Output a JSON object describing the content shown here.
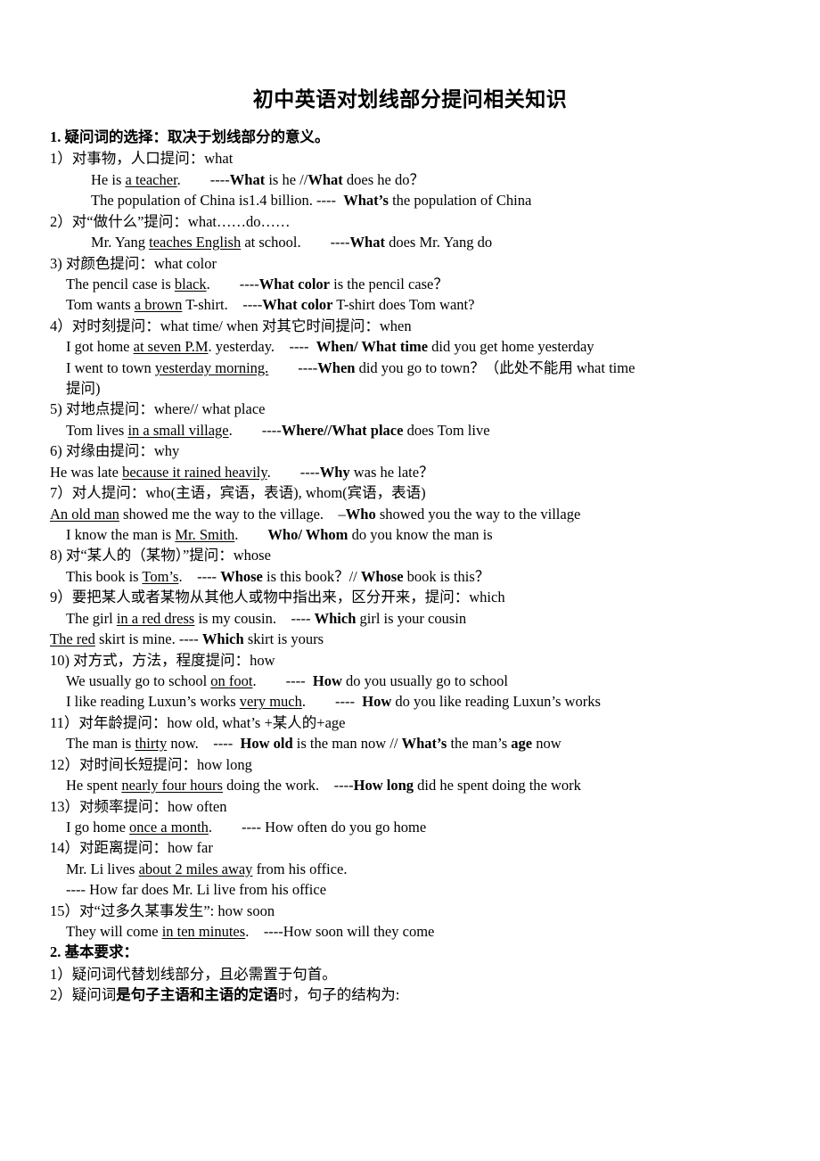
{
  "document": {
    "title": "初中英语对划线部分提问相关知识",
    "sections": [
      {
        "heading": "1.  疑问词的选择：取决于划线部分的意义。",
        "items": [
          {
            "id": "i1",
            "indent": 0,
            "html": "1）对事物，人口提问：what"
          },
          {
            "id": "i2",
            "indent": 2,
            "html": "He is <u>a teacher</u>.　　----<b>What</b> is he //<b>What</b> does he do？"
          },
          {
            "id": "i3",
            "indent": 2,
            "html": "The population of China is1.4 billion. ----  <b>What’s</b> the population of China"
          },
          {
            "id": "i4",
            "indent": 0,
            "html": "2）对“做什么”提问：what……do……"
          },
          {
            "id": "i5",
            "indent": 2,
            "html": "Mr. Yang <u>teaches English</u> at school.　　----<b>What</b> does Mr. Yang do"
          },
          {
            "id": "i6",
            "indent": 0,
            "html": "3) 对颜色提问：what color"
          },
          {
            "id": "i7",
            "indent": 1,
            "html": "The pencil case is <u>black</u>.　　----<b>What color</b> is the pencil case？"
          },
          {
            "id": "i8",
            "indent": 1,
            "html": "Tom wants <u>a brown</u> T-shirt.　----<b>What color</b> T-shirt does Tom want?"
          },
          {
            "id": "i9",
            "indent": 0,
            "html": "4）对时刻提问：what time/ when 对其它时间提问：when"
          },
          {
            "id": "i10",
            "indent": 1,
            "html": "I got home <u>at seven P.M</u>. yesterday.　----  <b>When/ What time</b> did you get home yesterday"
          },
          {
            "id": "i11",
            "indent": 1,
            "html": "I went to town <u>yesterday morning.</u>　　----<b>When</b> did you go to town？（此处不能用 what time"
          },
          {
            "id": "i12",
            "indent": 1,
            "html": "提问)"
          },
          {
            "id": "i13",
            "indent": 0,
            "html": "5) 对地点提问：where// what place"
          },
          {
            "id": "i14",
            "indent": 1,
            "html": "Tom lives <u>in a small village</u>.　　----<b>Where//What place</b> does Tom live"
          },
          {
            "id": "i15",
            "indent": 0,
            "html": "6) 对缘由提问：why"
          },
          {
            "id": "i16",
            "indent": 0,
            "html": "He was late <u>because it rained heavily</u>.　　----<b>Why</b> was he late？"
          },
          {
            "id": "i17",
            "indent": 0,
            "html": "7）对人提问：who(主语，宾语，表语), whom(宾语，表语)"
          },
          {
            "id": "i18",
            "indent": 0,
            "html": "<u>An old man</u> showed me the way to the village.　–<b>Who</b> showed you the way to the village"
          },
          {
            "id": "i19",
            "indent": 1,
            "html": "I know the man is <u>Mr. Smith</u>.　　<b>Who/ Whom</b> do you know the man is"
          },
          {
            "id": "i20",
            "indent": 0,
            "html": "8) 对“某人的（某物）”提问：whose"
          },
          {
            "id": "i21",
            "indent": 1,
            "html": "This book is <u>Tom’s</u>.　---- <b>Whose</b> is this book？// <b>Whose</b> book is this？"
          },
          {
            "id": "i22",
            "indent": 0,
            "html": "9）要把某人或者某物从其他人或物中指出来，区分开来，提问：which"
          },
          {
            "id": "i23",
            "indent": 1,
            "html": "The girl <u>in a red dress</u> is my cousin.　---- <b>Which</b> girl is your cousin"
          },
          {
            "id": "i24",
            "indent": 0,
            "html": "<u>The red</u> skirt is mine. ---- <b>Which</b> skirt is yours"
          },
          {
            "id": "i25",
            "indent": 0,
            "html": "10) 对方式，方法，程度提问：how"
          },
          {
            "id": "i26",
            "indent": 1,
            "html": "We usually go to school <u>on foot</u>.　　----  <b>How</b> do you usually go to school"
          },
          {
            "id": "i27",
            "indent": 1,
            "html": "I like reading Luxun’s works <u>very much</u>.　　----  <b>How</b> do you like reading Luxun’s works"
          },
          {
            "id": "i28",
            "indent": 0,
            "html": "11）对年龄提问：how old, what’s +某人的+age"
          },
          {
            "id": "i29",
            "indent": 1,
            "html": "The man is <u>thirty</u> now.　----  <b>How old</b> is the man now // <b>What’s</b> the man’s <b>age</b> now"
          },
          {
            "id": "i30",
            "indent": 0,
            "html": "12）对时间长短提问：how long"
          },
          {
            "id": "i31",
            "indent": 1,
            "html": "He spent <u>nearly four hours</u> doing the work.　----<b>How long</b> did he spent doing the work"
          },
          {
            "id": "i32",
            "indent": 0,
            "html": "13）对频率提问：how often"
          },
          {
            "id": "i33",
            "indent": 1,
            "html": "I go home <u>once a month</u>.　　---- How often do you go home"
          },
          {
            "id": "i34",
            "indent": 0,
            "html": "14）对距离提问：how far"
          },
          {
            "id": "i35",
            "indent": 1,
            "html": "Mr. Li lives <u>about 2 miles away</u> from his office."
          },
          {
            "id": "i36",
            "indent": 1,
            "html": "---- How far does Mr. Li live from his office"
          },
          {
            "id": "i37",
            "indent": 0,
            "html": "15）对“过多久某事发生”: how soon"
          },
          {
            "id": "i38",
            "indent": 1,
            "html": "They will come <u>in ten minutes</u>.　----How soon will they come"
          }
        ]
      },
      {
        "heading": "2.  基本要求：",
        "items": [
          {
            "id": "j1",
            "indent": 0,
            "html": "1）疑问词代替划线部分，且必需置于句首。"
          },
          {
            "id": "j2",
            "indent": 0,
            "html": "2）疑问词<b>是句子主语和主语的定语</b>时，句子的结构为:"
          }
        ]
      }
    ]
  }
}
